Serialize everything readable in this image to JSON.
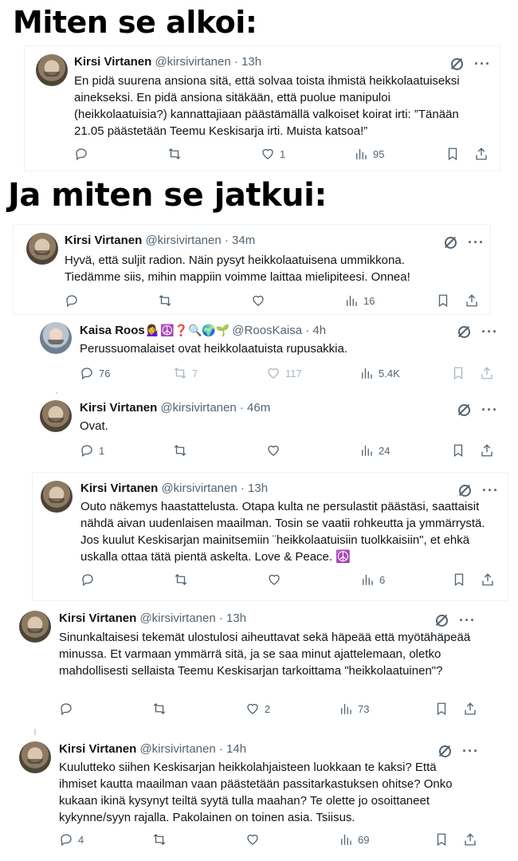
{
  "headings": {
    "first": "Miten se alkoi:",
    "second": "Ja miten se jatkui:"
  },
  "tweets": [
    {
      "name": "Kirsi Virtanen",
      "handle": "@kirsivirtanen",
      "time": "13h",
      "text": "En pidä suurena ansiona sitä, että solvaa toista ihmistä heikkolaatuiseksi ainekseksi. En pidä ansiona sitäkään, että puolue manipuloi (heikkolaatuisia?) kannattajiaan päästämällä valkoiset koirat irti: ”Tänään 21.05 päästetään Teemu Keskisarja irti. Muista katsoa!”",
      "replies": "",
      "reposts": "",
      "likes": "1",
      "views": "95"
    },
    {
      "name": "Kirsi Virtanen",
      "handle": "@kirsivirtanen",
      "time": "34m",
      "text": "Hyvä, että suljit radion. Näin pysyt heikkolaatuisena ummikkona. Tiedämme siis, mihin mappiin voimme laittaa mielipiteesi. Onnea!",
      "replies": "",
      "reposts": "",
      "likes": "",
      "views": "16"
    },
    {
      "name": "Kaisa Roos",
      "emojis": "💁‍♀️☮️❓🔍🌍🌱",
      "handle": "@RoosKaisa",
      "time": "4h",
      "text": "Perussuomalaiset ovat heikkolaatuista rupusakkia.",
      "replies": "76",
      "reposts": "7",
      "likes": "117",
      "views": "5.4K"
    },
    {
      "name": "Kirsi Virtanen",
      "handle": "@kirsivirtanen",
      "time": "46m",
      "text": "Ovat.",
      "replies": "1",
      "reposts": "",
      "likes": "",
      "views": "24"
    },
    {
      "name": "Kirsi Virtanen",
      "handle": "@kirsivirtanen",
      "time": "13h",
      "text": "Outo näkemys haastattelusta. Otapa kulta ne persulastit päästäsi, saattaisit nähdä aivan uudenlaisen maailman. Tosin se vaatii rohkeutta ja ymmärrystä. Jos kuulut Keskisarjan mainitsemiin ¨heikkolaatuisiin tuolkkaisiin\", et ehkä uskalla ottaa tätä pientä askelta. Love & Peace. ☮️",
      "replies": "",
      "reposts": "",
      "likes": "",
      "views": "6"
    },
    {
      "name": "Kirsi Virtanen",
      "handle": "@kirsivirtanen",
      "time": "13h",
      "text": "Sinunkaltaisesi tekemät ulostulosi aiheuttavat sekä häpeää että myötähäpeää minussa. Et varmaan ymmärrä sitä, ja se saa minut ajattelemaan, oletko mahdollisesti sellaista Teemu Keskisarjan tarkoittama \"heikkolaatuinen\"?",
      "replies": "",
      "reposts": "",
      "likes": "2",
      "views": "73"
    },
    {
      "name": "Kirsi Virtanen",
      "handle": "@kirsivirtanen",
      "time": "14h",
      "text": "Kuulutteko siihen Keskisarjan heikkolahjaisteen luokkaan te kaksi? Että ihmiset kautta maailman vaan päästetään passitarkastuksen ohitse? Onko kukaan ikinä kysynyt teiltä syytä tulla maahan? Te olette jo osoittaneet kykynne/syyn rajalla. Pakolainen on toinen asia. Tsiisus.",
      "replies": "4",
      "reposts": "",
      "likes": "",
      "views": "69"
    }
  ],
  "icons": {
    "reply": "reply-icon",
    "repost": "repost-icon",
    "like": "heart-icon",
    "views": "views-icon",
    "bookmark": "bookmark-icon",
    "share": "share-icon",
    "grok": "grok-icon",
    "more": "more-icon"
  },
  "colors": {
    "text": "#0f1419",
    "muted": "#536471",
    "border": "#eff3f4"
  }
}
